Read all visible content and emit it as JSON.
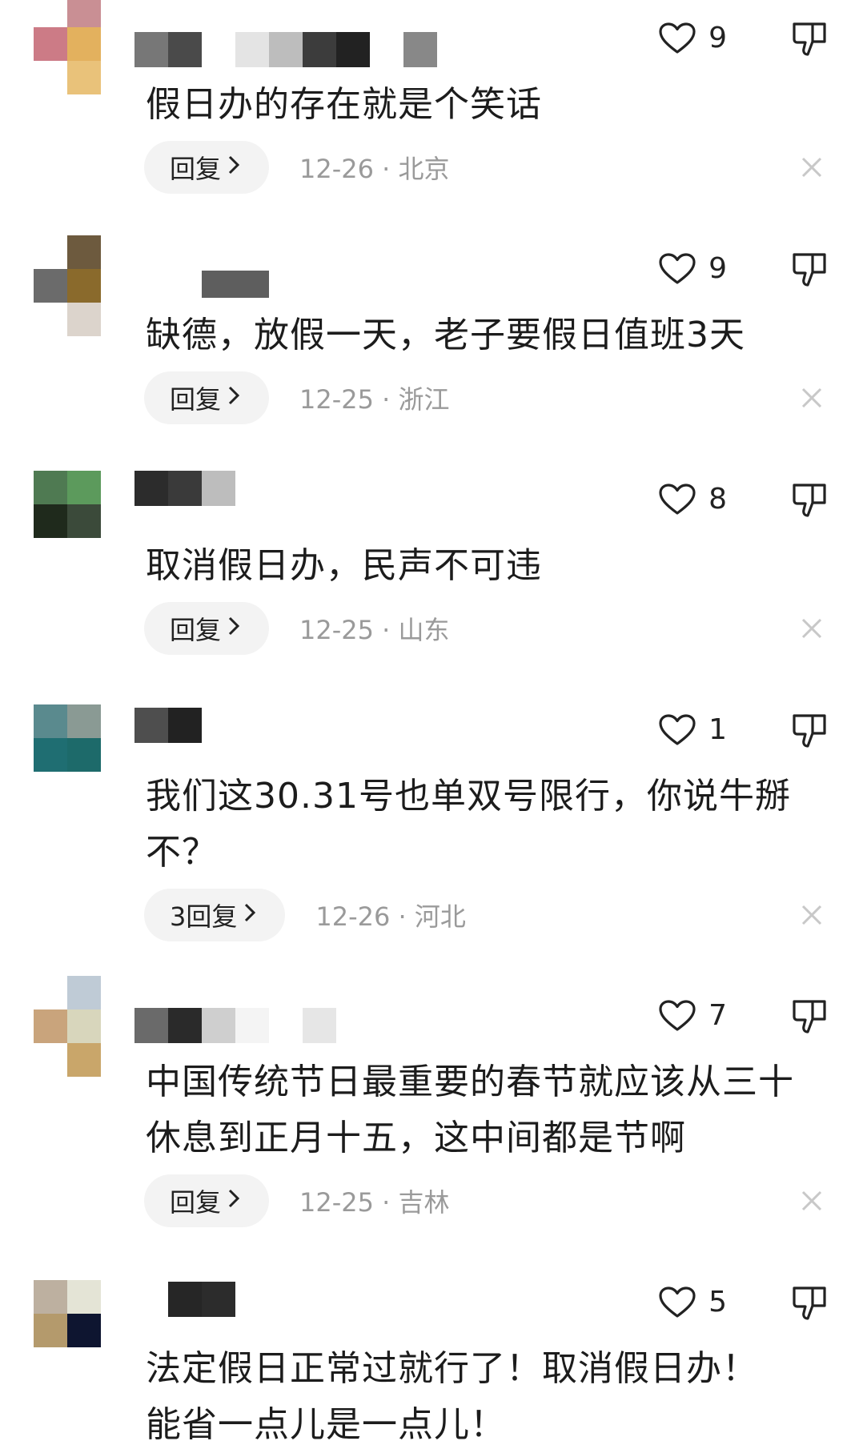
{
  "comments": [
    {
      "text": "假日办的存在就是个笑话",
      "likes": "9",
      "reply_label": "回复",
      "time_location": "12-26 · 北京"
    },
    {
      "text": "缺德，放假一天，老子要假日值班3天",
      "likes": "9",
      "reply_label": "回复",
      "time_location": "12-25 · 浙江"
    },
    {
      "text": "取消假日办，民声不可违",
      "likes": "8",
      "reply_label": "回复",
      "time_location": "12-25 · 山东"
    },
    {
      "text": "我们这30.31号也单双号限行，你说牛掰不？",
      "likes": "1",
      "reply_label": "3回复",
      "time_location": "12-26 · 河北"
    },
    {
      "text": "中国传统节日最重要的春节就应该从三十休息到正月十五，这中间都是节啊",
      "likes": "7",
      "reply_label": "回复",
      "time_location": "12-25 · 吉林"
    },
    {
      "text": "法定假日正常过就行了！取消假日办！能省一点儿是一点儿！",
      "likes": "5"
    }
  ],
  "icons": {
    "like": "heart-outline-icon",
    "dislike": "thumbs-down-outline-icon",
    "reply_arrow": "chevron-right-icon",
    "close": "close-icon"
  },
  "colors": {
    "reply_button_bg": "#f3f3f3",
    "meta_text": "#9a9a9a",
    "icon_gray": "#c8c8c8"
  }
}
